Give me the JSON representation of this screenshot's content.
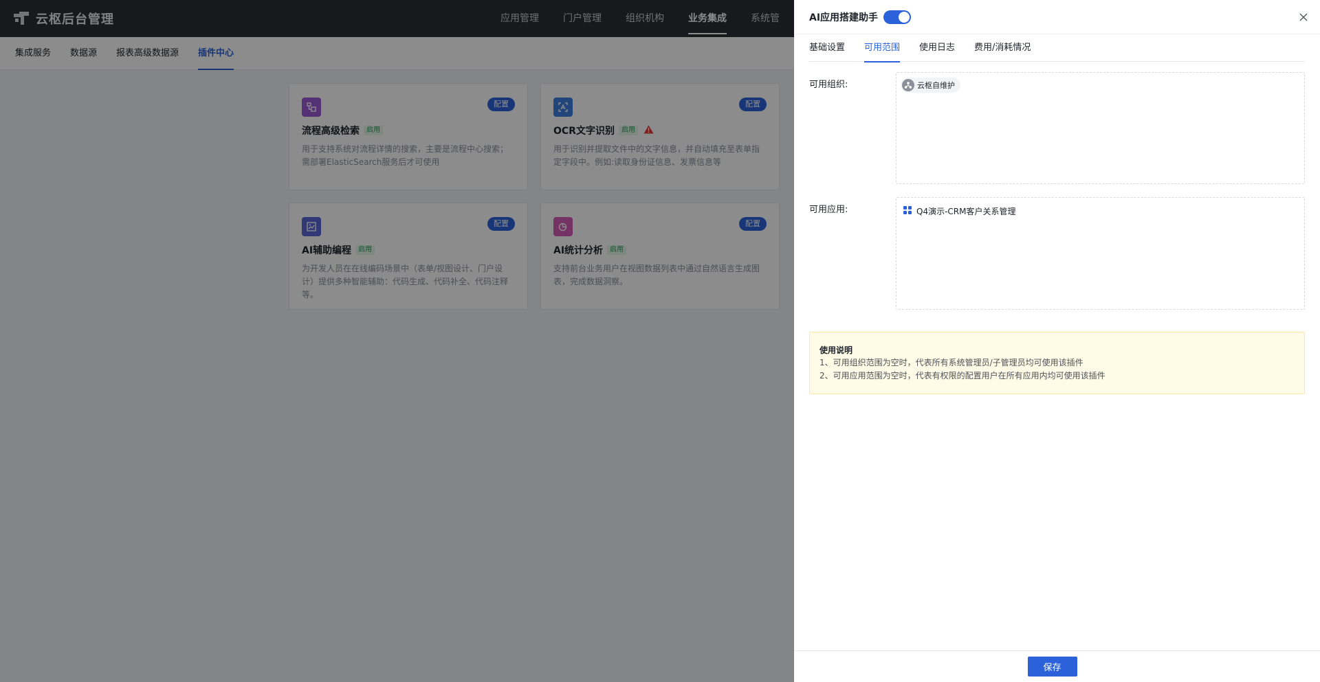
{
  "app": {
    "title": "云枢后台管理"
  },
  "topnav": {
    "items": [
      "应用管理",
      "门户管理",
      "组织机构",
      "业务集成",
      "系统管"
    ],
    "active": "业务集成"
  },
  "subnav": {
    "items": [
      "集成服务",
      "数据源",
      "报表高级数据源",
      "插件中心"
    ],
    "active": "插件中心"
  },
  "plugins": [
    {
      "title": "流程高级检索",
      "status": "启用",
      "config_label": "配置",
      "icon": "flow-search-icon",
      "color": "#9b5bd6",
      "description": "用于支持系统对流程详情的搜索，主要是流程中心搜索；需部署ElasticSearch服务后才可使用"
    },
    {
      "title": "OCR文字识别",
      "status": "启用",
      "config_label": "配置",
      "icon": "ocr-scan-icon",
      "color": "#3f7fe0",
      "warning": true,
      "description": "用于识别并提取文件中的文字信息，并自动填充至表单指定字段中。例如:读取身份证信息、发票信息等"
    },
    {
      "title": "AI辅助编程",
      "status": "启用",
      "config_label": "配置",
      "icon": "ai-code-icon",
      "color": "#5a67d8",
      "description": "为开发人员在在线编码场景中（表单/视图设计、门户设计）提供多种智能辅助：代码生成、代码补全、代码注释等。"
    },
    {
      "title": "AI统计分析",
      "status": "启用",
      "config_label": "配置",
      "icon": "ai-chart-icon",
      "color": "#d45bb8",
      "description": "支持前台业务用户在视图数据列表中通过自然语言生成图表，完成数据洞察。"
    }
  ],
  "drawer": {
    "title": "AI应用搭建助手",
    "enabled": true,
    "tabs": [
      "基础设置",
      "可用范围",
      "使用日志",
      "费用/消耗情况"
    ],
    "active_tab": "可用范围",
    "org_label": "可用组织:",
    "orgs": [
      "云枢自维护"
    ],
    "app_label": "可用应用:",
    "apps": [
      "Q4演示-CRM客户关系管理"
    ],
    "notice": {
      "title": "使用说明",
      "lines": [
        "1、可用组织范围为空时，代表所有系统管理员/子管理员均可使用该插件",
        "2、可用应用范围为空时，代表有权限的配置用户在所有应用内均可使用该插件"
      ]
    },
    "save_label": "保存"
  },
  "colors": {
    "primary": "#2b62d9",
    "topbar": "#2b2f36",
    "success": "#27a05a",
    "warning": "#e53935",
    "notice_bg": "#fffbe6"
  }
}
